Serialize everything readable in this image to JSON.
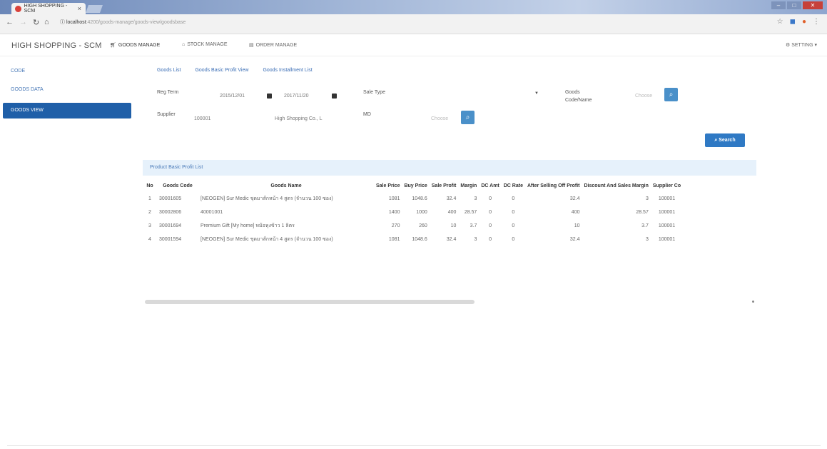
{
  "browser": {
    "tab_title": "HIGH SHOPPING - SCM",
    "tab_close": "×",
    "url_host": "localhost",
    "url_path": ":4200/goods-manage/goods-view/goodsbase"
  },
  "app": {
    "brand": "HIGH SHOPPING - SCM",
    "menus": [
      "GOODS MANAGE",
      "STOCK MANAGE",
      "ORDER MANAGE"
    ],
    "setting": "SETTING ▾"
  },
  "sidebar": {
    "items": [
      "CODE",
      "GOODS DATA",
      "GOODS VIEW"
    ]
  },
  "subtabs": [
    "Goods List",
    "Goods Basic Profit View",
    "Goods Installment List"
  ],
  "filters": {
    "reg_term_label": "Reg Term",
    "reg_from": "2015/12/01",
    "reg_to": "2017/11/20",
    "sale_type_label": "Sale Type",
    "goods_code_label_1": "Goods",
    "goods_code_label_2": "Code/Name",
    "goods_choose": "Choose",
    "supplier_label": "Supplier",
    "supplier_code": "100001",
    "supplier_name": "High Shopping Co., L",
    "md_label": "MD",
    "md_choose": "Choose",
    "search_label": "Search"
  },
  "panel": {
    "title": "Product Basic Profit List"
  },
  "table": {
    "headers": [
      "No",
      "Goods Code",
      "Goods Name",
      "Sale Price",
      "Buy Price",
      "Sale Profit",
      "Margin",
      "DC Amt",
      "DC Rate",
      "After Selling Off Profit",
      "Discount And Sales Margin",
      "Supplier Co"
    ],
    "rows": [
      [
        "1",
        "30001605",
        "[NEOGEN] Sur Medic ชุดมาส์กหน้า 4 สูตร (จำนวน 100 ซอง)",
        "1081",
        "1048.6",
        "32.4",
        "3",
        "0",
        "0",
        "32.4",
        "3",
        "100001"
      ],
      [
        "2",
        "30002806",
        "40001001",
        "",
        "1400",
        "1000",
        "400",
        "28.57",
        "0",
        "0",
        "400",
        "28.57"
      ],
      [
        "3",
        "30001694",
        "Premium Gift [My home] หม้อหุงข้าว 1 ลิตร",
        "270",
        "260",
        "10",
        "3.7",
        "0",
        "0",
        "10",
        "3.7",
        "100001"
      ],
      [
        "4",
        "30001594",
        "[NEOGEN] Sur Medic ชุดมาส์กหน้า 4 สูตร (จำนวน 100 ซอง)",
        "1081",
        "1048.6",
        "32.4",
        "3",
        "0",
        "0",
        "32.4",
        "3",
        "100001"
      ]
    ],
    "row2_supplier": "100001"
  }
}
